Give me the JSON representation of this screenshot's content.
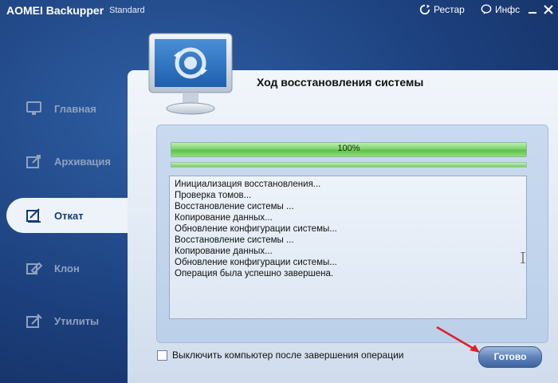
{
  "titlebar": {
    "app_name": "AOMEI Backupper",
    "edition": "Standard",
    "restore_label": "Рестар",
    "info_label": "Инфс"
  },
  "sidebar": {
    "items": [
      {
        "label": "Главная",
        "icon": "home-monitor-icon",
        "active": false
      },
      {
        "label": "Архивация",
        "icon": "backup-icon",
        "active": false
      },
      {
        "label": "Откат",
        "icon": "restore-icon",
        "active": true
      },
      {
        "label": "Клон",
        "icon": "clone-icon",
        "active": false
      },
      {
        "label": "Утилиты",
        "icon": "tools-icon",
        "active": false
      }
    ]
  },
  "main": {
    "title": "Ход восстановления системы",
    "progress": {
      "value_percent": 100,
      "label": "100%"
    },
    "log": [
      "Инициализация восстановления...",
      "Проверка томов...",
      "Восстановление системы ...",
      "Копирование данных...",
      "Обновление конфигурации системы...",
      "Восстановление системы ...",
      "Копирование данных...",
      "Обновление конфигурации системы...",
      "Операция была успешно завершена."
    ],
    "shutdown_checkbox_label": "Выключить компьютер после завершения операции",
    "shutdown_checked": false,
    "done_button": "Готово"
  },
  "colors": {
    "accent_blue": "#1c3f7c",
    "progress_green": "#7ed36c",
    "annotation_arrow": "#e0202a"
  }
}
